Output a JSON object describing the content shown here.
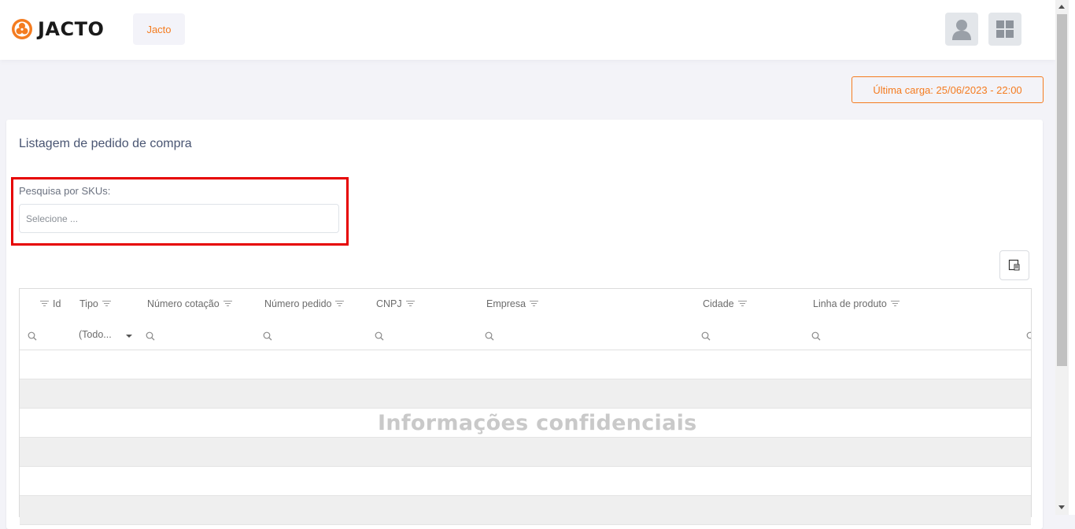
{
  "header": {
    "logo_text": "JACTO",
    "company_chip": "Jacto",
    "accent_color": "#f47c20"
  },
  "last_load": "Última carga: 25/06/2023 - 22:00",
  "page": {
    "title": "Listagem de pedido de compra",
    "sku_search": {
      "label": "Pesquisa por SKUs:",
      "placeholder": "Selecione ..."
    }
  },
  "grid": {
    "columns": [
      "Id",
      "Tipo",
      "Número cotação",
      "Número pedido",
      "CNPJ",
      "Empresa",
      "Cidade",
      "Linha de produto"
    ],
    "type_filter_value": "(Todo...",
    "rows": []
  },
  "watermark": "Informações confidenciais",
  "icons": {
    "logo": "jacto-logo-icon",
    "user": "user-avatar-icon",
    "apps": "apps-grid-icon",
    "export": "export-columns-icon",
    "filter": "filter-icon",
    "search": "search-icon"
  }
}
